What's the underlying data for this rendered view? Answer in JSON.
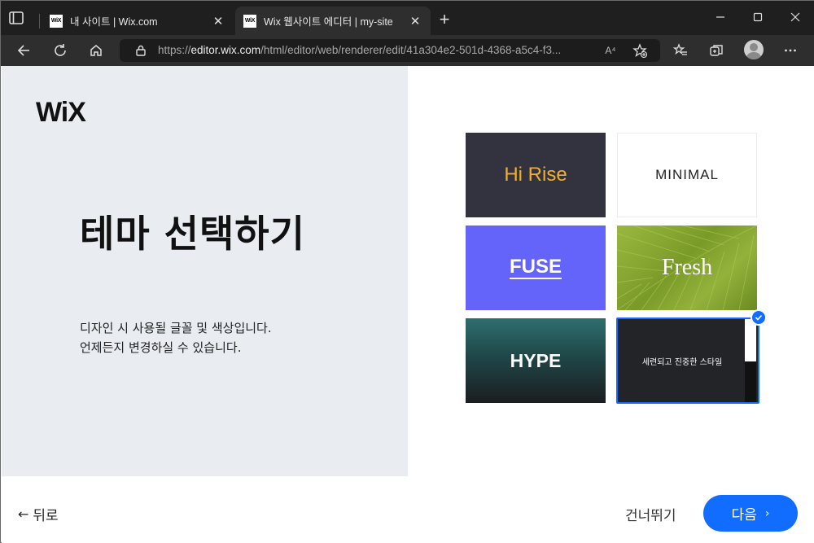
{
  "browser": {
    "tabs": [
      {
        "favicon": "WiX",
        "title": "내 사이트 | Wix.com",
        "active": false
      },
      {
        "favicon": "WiX",
        "title": "Wix 웹사이트 에디터 | my-site",
        "active": true
      }
    ],
    "new_tab_label": "+",
    "address": {
      "scheme": "https://",
      "host": "editor.wix.com",
      "path": "/html/editor/web/renderer/edit/41a304e2-501d-4368-a5c4-f3..."
    },
    "read_aloud_label": "A⁴",
    "icons": [
      "tab-actions-icon",
      "back-icon",
      "refresh-icon",
      "home-icon",
      "lock-icon",
      "read-aloud-icon",
      "add-favorite-icon",
      "favorites-icon",
      "collections-icon",
      "profile-avatar",
      "more-icon",
      "minimize-icon",
      "maximize-icon",
      "close-icon"
    ]
  },
  "page": {
    "logo": "WiX",
    "heading": "테마 선택하기",
    "description": [
      "디자인 시 사용될 글꼴 및 색상입니다.",
      "언제든지 변경하실 수 있습니다."
    ],
    "themes": [
      {
        "label": "Hi Rise",
        "color": "#33333f",
        "text_color": "#f2b02a"
      },
      {
        "label": "MINIMAL",
        "color": "#ffffff",
        "text_color": "#222222"
      },
      {
        "label": "FUSE",
        "color": "#6464fb",
        "text_color": "#ffffff"
      },
      {
        "label": "Fresh",
        "color": "#8aa833",
        "text_color": "#ffffff"
      },
      {
        "label": "HYPE",
        "color": "#1f4748",
        "text_color": "#ffffff"
      },
      {
        "label": "세련되고 진중한 스타일",
        "color": "#222428",
        "text_color": "#ffffff",
        "selected": true
      }
    ],
    "accent_color": "#116dff"
  },
  "footer": {
    "back_label": "뒤로",
    "skip_label": "건너뛰기",
    "next_label": "다음"
  }
}
